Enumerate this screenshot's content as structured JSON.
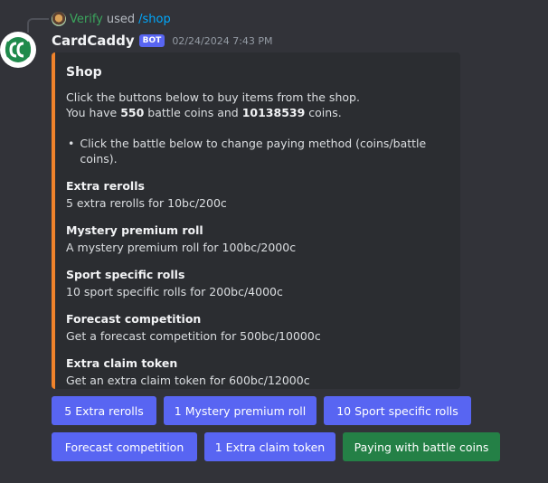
{
  "reply": {
    "user": "Verify",
    "used_text": "used",
    "command": "/shop"
  },
  "message": {
    "username": "CardCaddy",
    "badge": "BOT",
    "timestamp": "02/24/2024 7:43 PM"
  },
  "embed": {
    "accent_color": "#f0832b",
    "title": "Shop",
    "line1": "Click the buttons below to buy items from the shop.",
    "balance_prefix": "You have",
    "battle_coins": "550",
    "balance_mid": "battle coins and",
    "coins": "10138539",
    "balance_suffix": "coins.",
    "bullet": "Click the battle below to change paying method (coins/battle coins).",
    "fields": [
      {
        "name": "Extra rerolls",
        "value": "5 extra rerolls for 10bc/200c"
      },
      {
        "name": "Mystery premium roll",
        "value": "A mystery premium roll for 100bc/2000c"
      },
      {
        "name": "Sport specific rolls",
        "value": "10 sport specific rolls for 200bc/4000c"
      },
      {
        "name": "Forecast competition",
        "value": "Get a forecast competition for 500bc/10000c"
      },
      {
        "name": "Extra claim token",
        "value": "Get an extra claim token for 600bc/12000c"
      }
    ]
  },
  "buttons": {
    "row1": [
      "5 Extra rerolls",
      "1 Mystery premium roll",
      "10 Sport specific rolls"
    ],
    "row2": [
      "Forecast competition",
      "1 Extra claim token",
      "Paying with battle coins"
    ]
  },
  "colors": {
    "primary": "#5865f2",
    "success": "#248046",
    "background": "#323339",
    "embed": "#2b2d31"
  }
}
